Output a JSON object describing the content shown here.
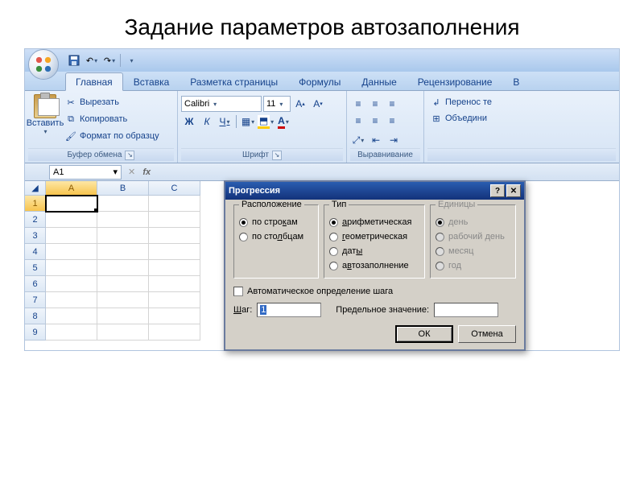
{
  "slide_title": "Задание параметров автозаполнения",
  "tabs": [
    "Главная",
    "Вставка",
    "Разметка страницы",
    "Формулы",
    "Данные",
    "Рецензирование",
    "В"
  ],
  "clipboard": {
    "paste": "Вставить",
    "cut": "Вырезать",
    "copy": "Копировать",
    "format": "Формат по образцу",
    "label": "Буфер обмена"
  },
  "font": {
    "name": "Calibri",
    "size": "11",
    "label": "Шрифт"
  },
  "alignment": {
    "label": "Выравнивание",
    "wrap": "Перенос те",
    "merge": "Объедини"
  },
  "namebox": "A1",
  "cols": [
    "A",
    "B",
    "C"
  ],
  "rows": [
    "1",
    "2",
    "3",
    "4",
    "5",
    "6",
    "7",
    "8",
    "9"
  ],
  "dialog": {
    "title": "Прогрессия",
    "location": {
      "label": "Расположение",
      "rows": "по строкам",
      "cols": "по столбцам"
    },
    "type": {
      "label": "Тип",
      "arith": "арифметическая",
      "geo": "геометрическая",
      "dates": "даты",
      "auto": "автозаполнение"
    },
    "units": {
      "label": "Единицы",
      "day": "день",
      "wday": "рабочий день",
      "month": "месяц",
      "year": "год"
    },
    "autostep": "Автоматическое определение шага",
    "step_label": "Шаг:",
    "step_value": "1",
    "limit_label": "Предельное значение:",
    "ok": "ОК",
    "cancel": "Отмена"
  }
}
